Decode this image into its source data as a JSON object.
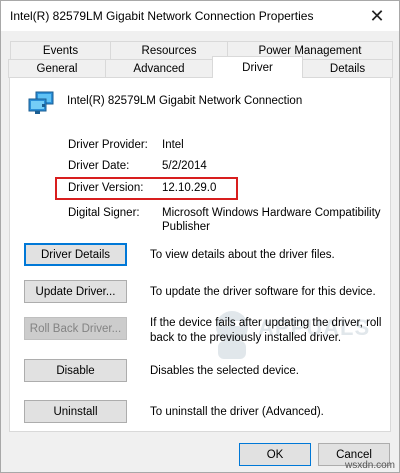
{
  "window": {
    "title": "Intel(R) 82579LM Gigabit Network Connection Properties",
    "close_glyph": "✕"
  },
  "tabs": {
    "row1": [
      "Events",
      "Resources",
      "Power Management"
    ],
    "row2": [
      "General",
      "Advanced",
      "Driver",
      "Details"
    ],
    "active": "Driver"
  },
  "device": {
    "icon": "network-adapter-icon",
    "name": "Intel(R) 82579LM Gigabit Network Connection"
  },
  "info": {
    "provider_label": "Driver Provider:",
    "provider_value": "Intel",
    "date_label": "Driver Date:",
    "date_value": "5/2/2014",
    "version_label": "Driver Version:",
    "version_value": "12.10.29.0",
    "signer_label": "Digital Signer:",
    "signer_value_line1": "Microsoft Windows Hardware Compatibility",
    "signer_value_line2": "Publisher"
  },
  "actions": {
    "details_label": "Driver Details",
    "details_desc": "To view details about the driver files.",
    "update_label": "Update Driver...",
    "update_desc": "To update the driver software for this device.",
    "rollback_label": "Roll Back Driver...",
    "rollback_desc_line1": "If the device fails after updating the driver, roll",
    "rollback_desc_line2": "back to the previously installed driver.",
    "disable_label": "Disable",
    "disable_desc": "Disables the selected device.",
    "uninstall_label": "Uninstall",
    "uninstall_desc": "To uninstall the driver (Advanced)."
  },
  "footer": {
    "ok_label": "OK",
    "cancel_label": "Cancel"
  },
  "watermark": {
    "text": "APPUALS",
    "site": "wsxdn.com"
  },
  "colors": {
    "highlight": "#d81e1e",
    "focus": "#0078d7"
  }
}
